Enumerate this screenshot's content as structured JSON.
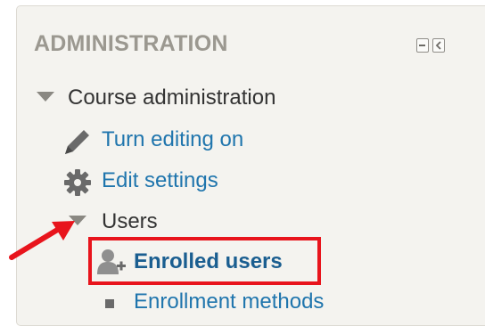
{
  "block": {
    "title": "ADMINISTRATION",
    "controls": {
      "hide_icon": "minus-box-icon",
      "dock_icon": "dock-left-icon"
    }
  },
  "tree": {
    "course_admin": {
      "label": "Course administration",
      "icon": "triangle-down-icon"
    },
    "turn_editing": {
      "label": "Turn editing on",
      "icon": "pencil-icon"
    },
    "edit_settings": {
      "label": "Edit settings",
      "icon": "gear-icon"
    },
    "users": {
      "label": "Users",
      "icon": "triangle-down-icon"
    },
    "enrolled_users": {
      "label": "Enrolled users",
      "icon": "user-add-icon"
    },
    "enrollment_methods": {
      "label": "Enrollment methods",
      "icon": "bullet-icon"
    }
  },
  "annotation": {
    "arrow_color": "#e8141c",
    "box_color": "#e8141c"
  }
}
